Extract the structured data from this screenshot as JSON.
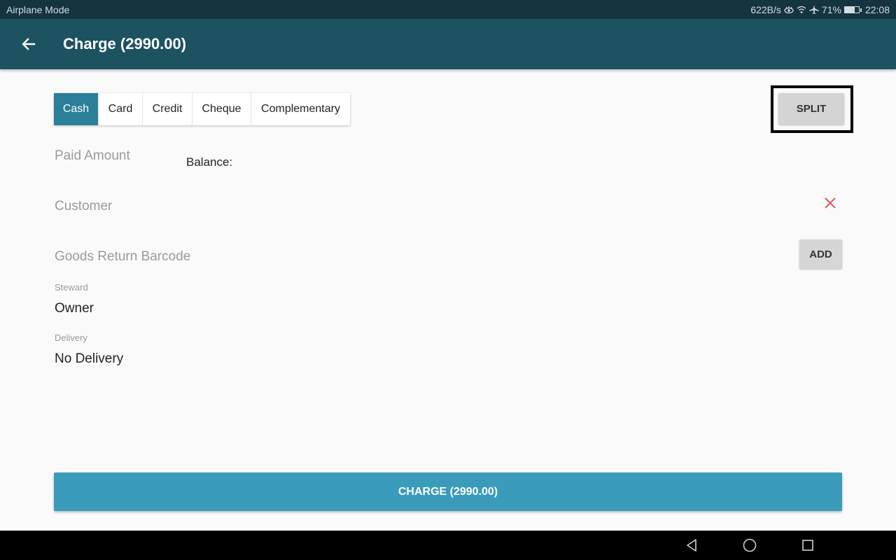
{
  "status_bar": {
    "left_text": "Airplane Mode",
    "network_speed": "622B/s",
    "icons": [
      "eye-comfort-icon",
      "wifi-icon",
      "airplane-icon"
    ],
    "battery_percent": "71%",
    "time": "22:08"
  },
  "app_bar": {
    "back_icon": "arrow-left-icon",
    "title": "Charge (2990.00)"
  },
  "payment_tabs": {
    "selected": "Cash",
    "items": [
      {
        "label": "Cash",
        "active": true
      },
      {
        "label": "Card",
        "active": false
      },
      {
        "label": "Credit",
        "active": false
      },
      {
        "label": "Cheque",
        "active": false
      },
      {
        "label": "Complementary",
        "active": false
      }
    ]
  },
  "split_button": {
    "label": "SPLIT"
  },
  "form": {
    "paid_amount": {
      "placeholder": "Paid Amount",
      "value": ""
    },
    "balance_label": "Balance:",
    "customer": {
      "placeholder": "Customer",
      "value": "",
      "clear_icon": "close-icon"
    },
    "goods_return_barcode": {
      "placeholder": "Goods Return Barcode",
      "value": ""
    },
    "add_button": {
      "label": "ADD"
    },
    "steward": {
      "label": "Steward",
      "value": "Owner"
    },
    "delivery": {
      "label": "Delivery",
      "value": "No Delivery"
    }
  },
  "charge_button": {
    "label": "CHARGE (2990.00)"
  },
  "colors": {
    "status_bar": "#143440",
    "app_bar": "#1d5261",
    "active_tab": "#2b7f98",
    "charge_button": "#3a9bba",
    "clear_icon": "#e0585a",
    "highlight_frame": "#000000"
  },
  "nav_bar": {
    "back_icon": "triangle-back-icon",
    "home_icon": "circle-home-icon",
    "recents_icon": "square-recents-icon"
  }
}
